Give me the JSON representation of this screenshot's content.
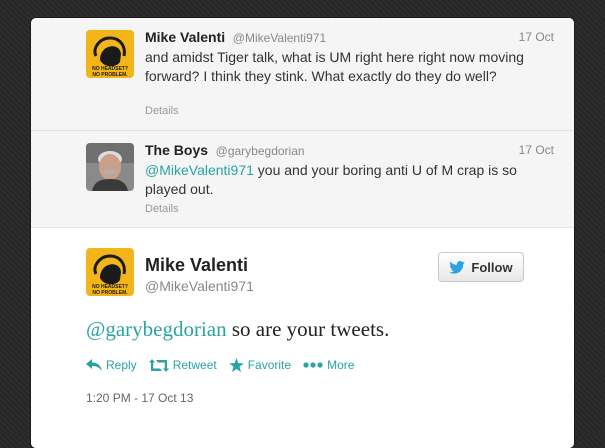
{
  "tweets": [
    {
      "name": "Mike Valenti",
      "handle": "@MikeValenti971",
      "date": "17 Oct",
      "text": "and amidst Tiger talk, what is UM right here right now moving forward? I think they stink. What exactly do they do well?",
      "details": "Details",
      "avatar": "valenti-avatar"
    },
    {
      "name": "The Boys",
      "handle": "@garybegdorian",
      "date": "17 Oct",
      "mention": "@MikeValenti971",
      "text": " you and your boring anti U of M crap is so played out.",
      "details": "Details",
      "avatar": "person-photo-avatar"
    }
  ],
  "main": {
    "name": "Mike Valenti",
    "handle": "@MikeValenti971",
    "follow_label": "Follow",
    "mention": "@garybegdorian",
    "text": " so are your tweets.",
    "actions": {
      "reply": "Reply",
      "retweet": "Retweet",
      "favorite": "Favorite",
      "more": "More"
    },
    "timestamp": "1:20 PM - 17 Oct 13"
  },
  "avatar_text": {
    "line1": "NO HEADSET?",
    "line2": "NO PROBLEM."
  },
  "colors": {
    "accent": "#2aa3a3",
    "twitter_blue": "#2fa3e0",
    "avatar_yellow": "#f2b51a"
  }
}
